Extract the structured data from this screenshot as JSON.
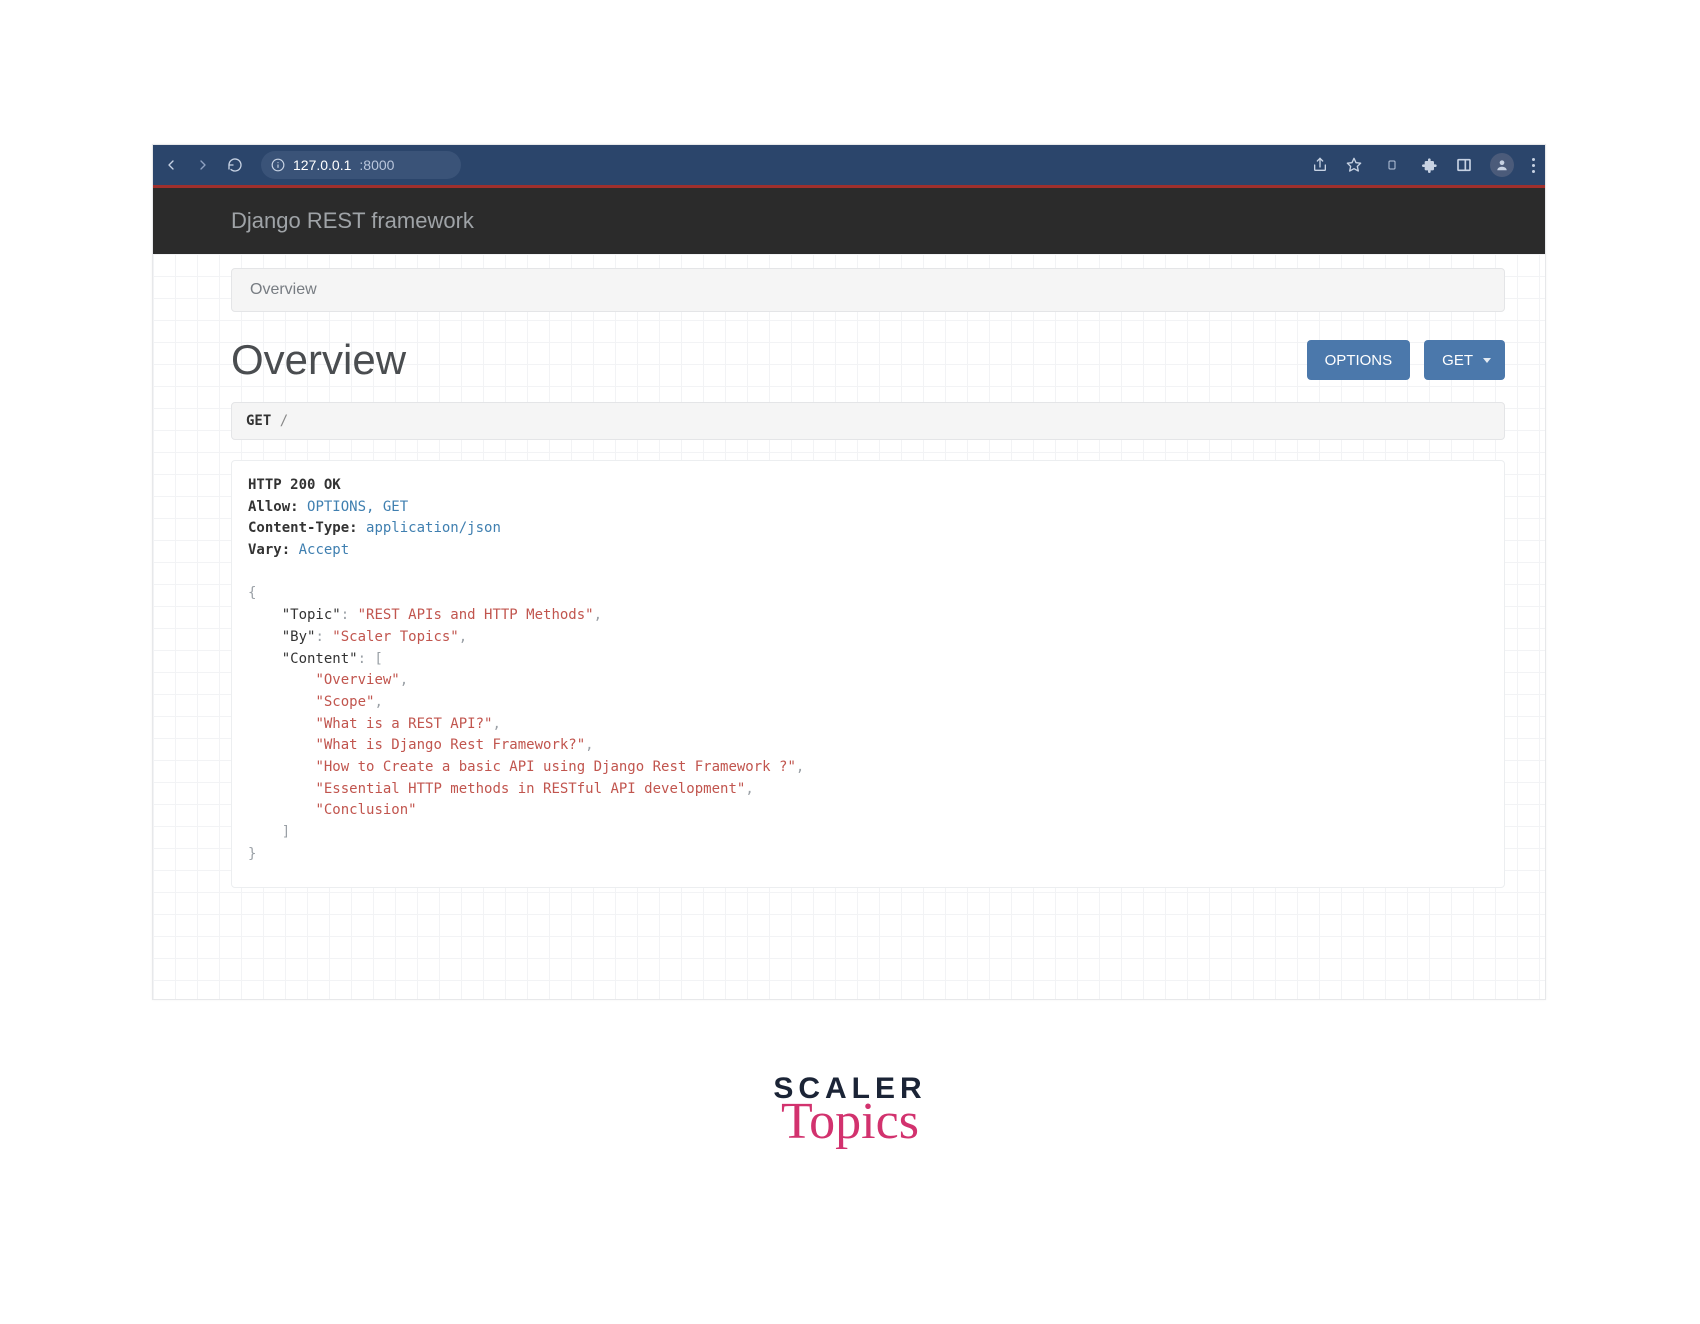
{
  "browser": {
    "url_host": "127.0.0.1",
    "url_port": ":8000"
  },
  "header": {
    "brand": "Django REST framework"
  },
  "breadcrumb": {
    "label": "Overview"
  },
  "page": {
    "title": "Overview"
  },
  "actions": {
    "options_label": "OPTIONS",
    "get_label": "GET"
  },
  "request": {
    "method": "GET",
    "path": "/"
  },
  "response": {
    "status_line": "HTTP 200 OK",
    "headers": [
      {
        "k": "Allow",
        "v": "OPTIONS, GET"
      },
      {
        "k": "Content-Type",
        "v": "application/json"
      },
      {
        "k": "Vary",
        "v": "Accept"
      }
    ],
    "body": {
      "Topic": "REST APIs and HTTP Methods",
      "By": "Scaler Topics",
      "Content": [
        "Overview",
        "Scope",
        "What is a REST API?",
        "What is Django Rest Framework?",
        "How to Create a basic API using Django Rest Framework ?",
        "Essential HTTP methods in RESTful API development",
        "Conclusion"
      ]
    }
  },
  "logo": {
    "line1": "SCALER",
    "line2": "Topics"
  }
}
